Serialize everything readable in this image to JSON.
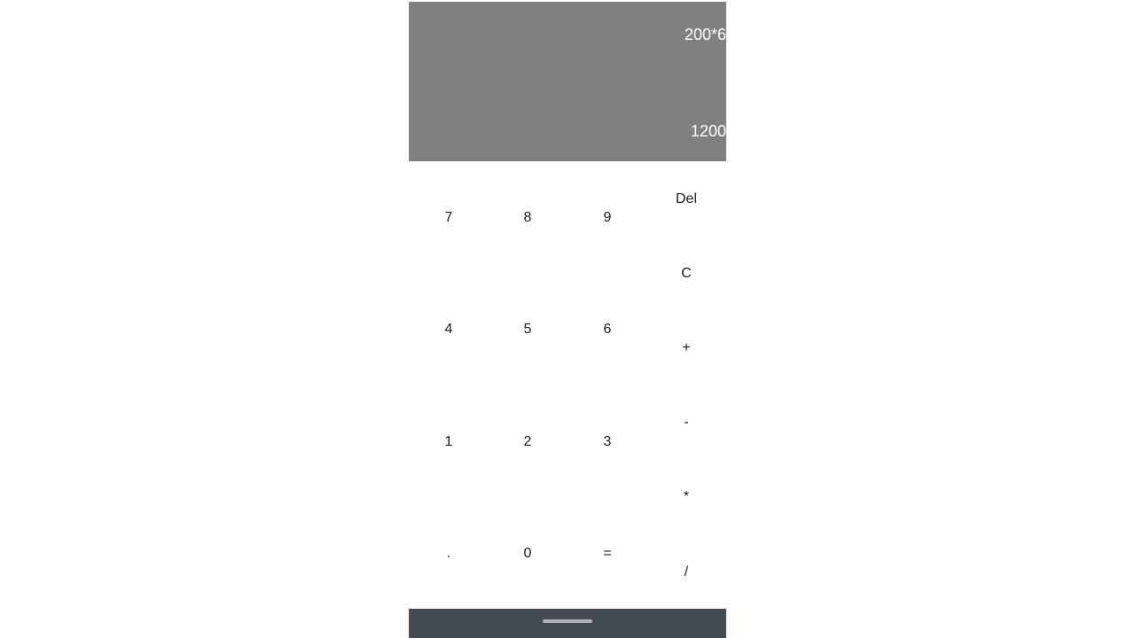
{
  "display": {
    "expression": "200*6",
    "result": "1200"
  },
  "keys": {
    "k7": "7",
    "k8": "8",
    "k9": "9",
    "k4": "4",
    "k5": "5",
    "k6": "6",
    "k1": "1",
    "k2": "2",
    "k3": "3",
    "dot": ".",
    "k0": "0",
    "equals": "=",
    "del": "Del",
    "clear": "C",
    "plus": "+",
    "minus": "-",
    "multiply": "*",
    "divide": "/"
  },
  "colors": {
    "display_bg": "#808080",
    "display_text": "#ffffff",
    "navbar_bg": "#454b52"
  }
}
